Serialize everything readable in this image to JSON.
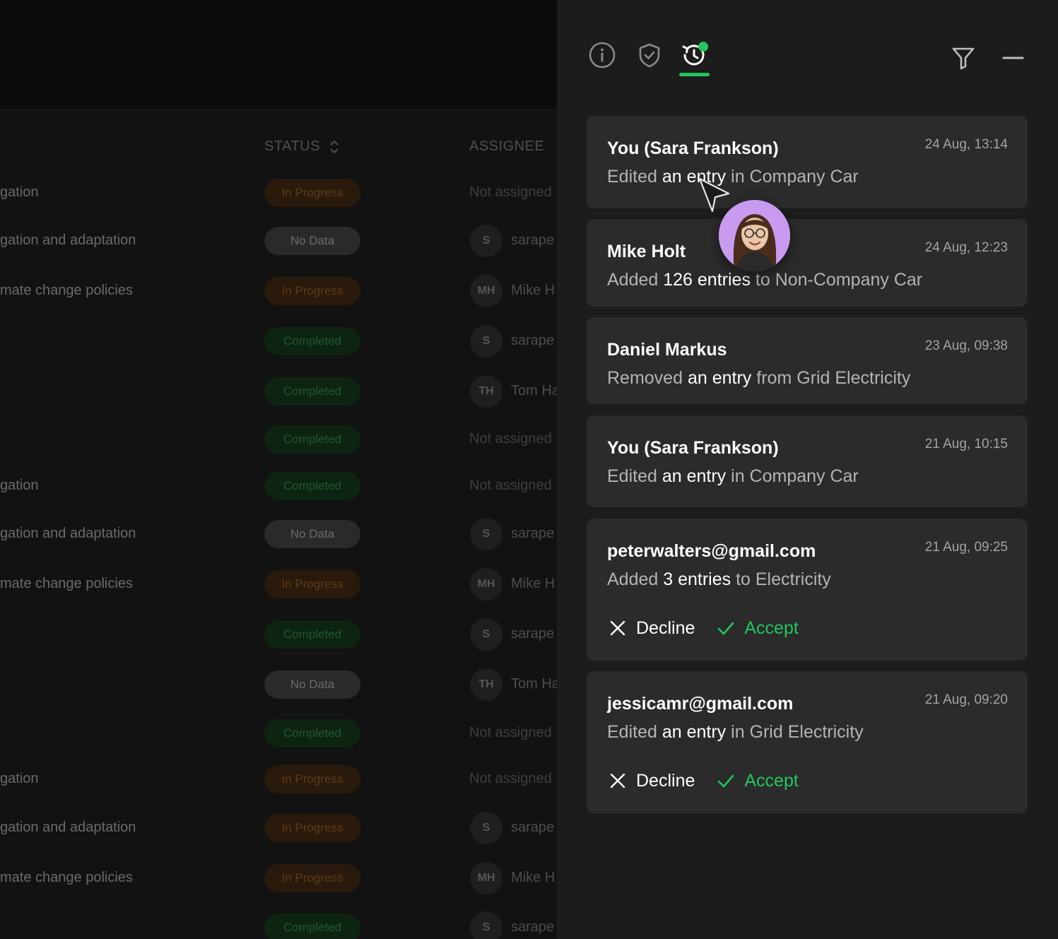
{
  "table": {
    "columns": {
      "status": "STATUS",
      "assignee": "ASSIGNEE"
    },
    "rows": [
      {
        "task": "gation",
        "status": "In Progress",
        "status_kind": "in-progress",
        "assignee_initials": "",
        "assignee": "Not assigned"
      },
      {
        "task": "gation and adaptation",
        "status": "No Data",
        "status_kind": "no-data",
        "assignee_initials": "S",
        "assignee": "sarape"
      },
      {
        "task": "mate change policies",
        "status": "In Progress",
        "status_kind": "in-progress",
        "assignee_initials": "MH",
        "assignee": "Mike H"
      },
      {
        "task": "",
        "status": "Completed",
        "status_kind": "completed",
        "assignee_initials": "S",
        "assignee": "sarape"
      },
      {
        "task": "",
        "status": "Completed",
        "status_kind": "completed",
        "assignee_initials": "TH",
        "assignee": "Tom Ha"
      },
      {
        "task": "",
        "status": "Completed",
        "status_kind": "completed",
        "assignee_initials": "",
        "assignee": "Not assigned"
      },
      {
        "task": "gation",
        "status": "Completed",
        "status_kind": "completed",
        "assignee_initials": "",
        "assignee": "Not assigned"
      },
      {
        "task": "gation and adaptation",
        "status": "No Data",
        "status_kind": "no-data",
        "assignee_initials": "S",
        "assignee": "sarape"
      },
      {
        "task": "mate change policies",
        "status": "In Progress",
        "status_kind": "in-progress",
        "assignee_initials": "MH",
        "assignee": "Mike H"
      },
      {
        "task": "",
        "status": "Completed",
        "status_kind": "completed",
        "assignee_initials": "S",
        "assignee": "sarape"
      },
      {
        "task": "",
        "status": "No Data",
        "status_kind": "no-data",
        "assignee_initials": "TH",
        "assignee": "Tom Ha"
      },
      {
        "task": "",
        "status": "Completed",
        "status_kind": "completed",
        "assignee_initials": "",
        "assignee": "Not assigned"
      },
      {
        "task": "gation",
        "status": "In Progress",
        "status_kind": "in-progress",
        "assignee_initials": "",
        "assignee": "Not assigned"
      },
      {
        "task": "gation and adaptation",
        "status": "In Progress",
        "status_kind": "in-progress",
        "assignee_initials": "S",
        "assignee": "sarape"
      },
      {
        "task": "mate change policies",
        "status": "In Progress",
        "status_kind": "in-progress",
        "assignee_initials": "MH",
        "assignee": "Mike H"
      },
      {
        "task": "",
        "status": "Completed",
        "status_kind": "completed",
        "assignee_initials": "S",
        "assignee": "sarape"
      }
    ]
  },
  "panel": {
    "tabs": [
      {
        "name": "info",
        "icon": "info-icon",
        "active": false
      },
      {
        "name": "security",
        "icon": "shield-check-icon",
        "active": false
      },
      {
        "name": "history",
        "icon": "history-icon",
        "active": true,
        "has_notification": true
      }
    ],
    "toolbar": {
      "filter_icon": "filter-icon",
      "minimize_icon": "minimize-icon"
    },
    "accent_color": "#22c55e",
    "activity": [
      {
        "who": "You (Sara Frankson)",
        "time": "24 Aug, 13:14",
        "parts": [
          {
            "text": "Edited ",
            "strong": false
          },
          {
            "text": "an entry",
            "strong": true
          },
          {
            "text": " in Company Car",
            "strong": false
          }
        ],
        "actions": false
      },
      {
        "who": "Mike Holt",
        "time": "24 Aug, 12:23",
        "parts": [
          {
            "text": "Added ",
            "strong": false
          },
          {
            "text": "126 entries",
            "strong": true
          },
          {
            "text": " to Non-Company Car",
            "strong": false
          }
        ],
        "actions": false
      },
      {
        "who": "Daniel Markus",
        "time": "23 Aug, 09:38",
        "parts": [
          {
            "text": "Removed ",
            "strong": false
          },
          {
            "text": "an entry",
            "strong": true
          },
          {
            "text": " from Grid Electricity",
            "strong": false
          }
        ],
        "actions": false
      },
      {
        "who": "You (Sara Frankson)",
        "time": "21 Aug, 10:15",
        "parts": [
          {
            "text": "Edited ",
            "strong": false
          },
          {
            "text": "an entry",
            "strong": true
          },
          {
            "text": " in Company Car",
            "strong": false
          }
        ],
        "actions": false
      },
      {
        "who": "peterwalters@gmail.com",
        "time": "21 Aug, 09:25",
        "parts": [
          {
            "text": "Added ",
            "strong": false
          },
          {
            "text": "3 entries",
            "strong": true
          },
          {
            "text": " to Electricity",
            "strong": false
          }
        ],
        "actions": true
      },
      {
        "who": "jessicamr@gmail.com",
        "time": "21 Aug, 09:20",
        "parts": [
          {
            "text": "Edited ",
            "strong": false
          },
          {
            "text": "an entry",
            "strong": true
          },
          {
            "text": " in Grid Electricity",
            "strong": false
          }
        ],
        "actions": true
      }
    ],
    "decline_label": "Decline",
    "accept_label": "Accept"
  }
}
